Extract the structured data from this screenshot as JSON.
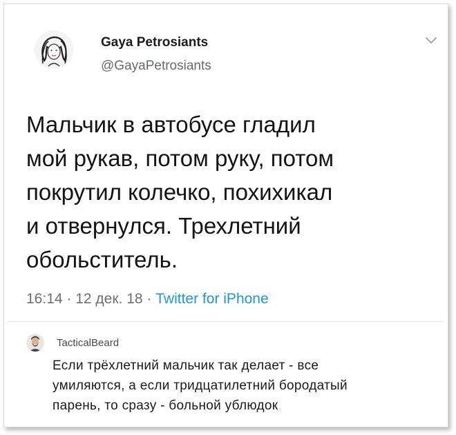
{
  "tweet": {
    "author_name": "Gaya Petrosiants",
    "author_handle": "@GayaPetrosiants",
    "text": "Мальчик в автобусе гладил\nмой рукав, потом руку, потом\nпокрутил колечко, похихикал\nи отвернулся. Трехлетний\nобольститель.",
    "time": "16:14",
    "separator": " · ",
    "date": "12 дек. 18",
    "source": "Twitter for iPhone",
    "avatar_icon": "woman-portrait-icon",
    "menu_icon": "chevron-down-icon"
  },
  "comment": {
    "author": "TacticalBeard",
    "avatar_icon": "bearded-man-avatar-icon",
    "text": "Если трёхлетний мальчик так делает - все\nумиляются,  а если тридцатилетний бородатый\nпарень, то сразу -  больной ублюдок"
  },
  "colors": {
    "link": "#1e96d8",
    "text": "#141414",
    "muted": "#6b6f74"
  }
}
